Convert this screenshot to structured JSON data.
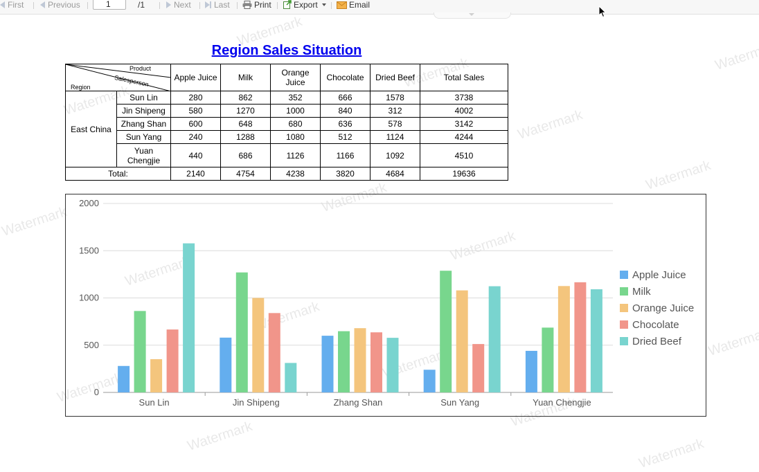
{
  "toolbar": {
    "first": "First",
    "previous": "Previous",
    "page_value": "1",
    "page_total": "/1",
    "next": "Next",
    "last": "Last",
    "print": "Print",
    "export": "Export",
    "email": "Email"
  },
  "watermark": "Watermark",
  "report": {
    "title": "Region Sales Situation",
    "corner": {
      "product": "Product",
      "salesperson": "Salesperson",
      "region": "Region"
    },
    "columns": [
      "Apple Juice",
      "Milk",
      "Orange Juice",
      "Chocolate",
      "Dried Beef",
      "Total Sales"
    ],
    "column_line2": [
      "",
      "",
      "Juice",
      "",
      "",
      ""
    ],
    "column_line1": [
      "Apple Juice",
      "Milk",
      "Orange",
      "Chocolate",
      "Dried Beef",
      "Total Sales"
    ],
    "region": "East China",
    "rows": [
      {
        "salesperson": "Sun Lin",
        "values": [
          "280",
          "862",
          "352",
          "666",
          "1578",
          "3738"
        ]
      },
      {
        "salesperson": "Jin Shipeng",
        "values": [
          "580",
          "1270",
          "1000",
          "840",
          "312",
          "4002"
        ]
      },
      {
        "salesperson": "Zhang Shan",
        "values": [
          "600",
          "648",
          "680",
          "636",
          "578",
          "3142"
        ]
      },
      {
        "salesperson": "Sun Yang",
        "values": [
          "240",
          "1288",
          "1080",
          "512",
          "1124",
          "4244"
        ]
      },
      {
        "salesperson_line1": "Yuan",
        "salesperson_line2": "Chengjie",
        "values": [
          "440",
          "686",
          "1126",
          "1166",
          "1092",
          "4510"
        ]
      }
    ],
    "total_label": "Total:",
    "totals": [
      "2140",
      "4754",
      "4238",
      "3820",
      "4684",
      "19636"
    ]
  },
  "chart_data": {
    "type": "bar",
    "categories": [
      "Sun Lin",
      "Jin Shipeng",
      "Zhang Shan",
      "Sun Yang",
      "Yuan Chengjie"
    ],
    "series": [
      {
        "name": "Apple Juice",
        "color": "#64aeee",
        "values": [
          280,
          580,
          600,
          240,
          440
        ]
      },
      {
        "name": "Milk",
        "color": "#78d68d",
        "values": [
          862,
          1270,
          648,
          1288,
          686
        ]
      },
      {
        "name": "Orange Juice",
        "color": "#f4c57d",
        "values": [
          352,
          1000,
          680,
          1080,
          1126
        ]
      },
      {
        "name": "Chocolate",
        "color": "#f1958a",
        "values": [
          666,
          840,
          636,
          512,
          1166
        ]
      },
      {
        "name": "Dried Beef",
        "color": "#79d4cf",
        "values": [
          1578,
          312,
          578,
          1124,
          1092
        ]
      }
    ],
    "ylim": [
      0,
      2000
    ],
    "yticks": [
      "0",
      "500",
      "1000",
      "1500",
      "2000"
    ],
    "grid": true,
    "legend": "right"
  }
}
